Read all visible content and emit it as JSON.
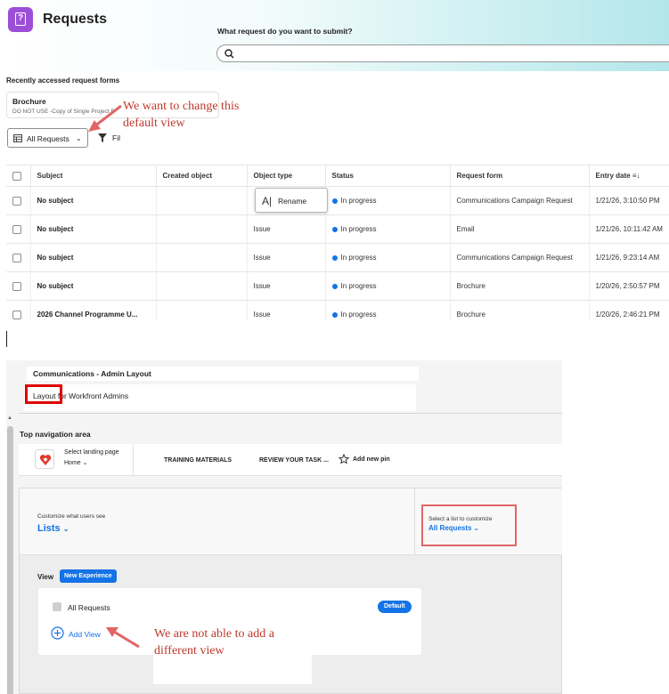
{
  "top": {
    "title": "Requests",
    "search_prompt": "What request do you want to submit?",
    "search_placeholder": "",
    "recent_label": "Recently accessed request forms",
    "recent_card": {
      "title": "Brochure",
      "subtitle": "DO NOT USE -Copy of Single Project B"
    },
    "view_selector": "All Requests",
    "filter_label": "Fil",
    "annotation": "We want to change this default view",
    "table": {
      "headers": [
        "Subject",
        "Created object",
        "Object type",
        "Status",
        "Request form",
        "Entry date"
      ],
      "rows": [
        {
          "subject": "No subject",
          "created": "",
          "type": "",
          "status": "In progress",
          "form": "Communications Campaign Request",
          "date": "1/21/26, 3:10:50 PM"
        },
        {
          "subject": "No subject",
          "created": "",
          "type": "Issue",
          "status": "In progress",
          "form": "Email",
          "date": "1/21/26, 10:11:42 AM"
        },
        {
          "subject": "No subject",
          "created": "",
          "type": "Issue",
          "status": "In progress",
          "form": "Communications Campaign Request",
          "date": "1/21/26, 9:23:14 AM"
        },
        {
          "subject": "No subject",
          "created": "",
          "type": "Issue",
          "status": "In progress",
          "form": "Brochure",
          "date": "1/20/26, 2:50:57 PM"
        },
        {
          "subject": "2026 Channel Programme U...",
          "created": "",
          "type": "Issue",
          "status": "In progress",
          "form": "Brochure",
          "date": "1/20/26, 2:46:21 PM"
        }
      ]
    },
    "rename_popup": "Rename"
  },
  "admin": {
    "layout_name": "Communications - Admin Layout",
    "layout_desc_highlight": "Layout",
    "layout_desc_rest": " for Workfront Admins",
    "topnav_label": "Top navigation area",
    "nav": {
      "landing_label": "Select landing page",
      "landing_value": "Home",
      "items": [
        "TRAINING MATERIALS",
        "REVIEW YOUR TASK ..."
      ],
      "add_pin": "Add new pin"
    },
    "customize_label": "Customize what users see",
    "customize_value": "Lists",
    "select_list_label": "Select a list to customize",
    "select_list_value": "All Requests",
    "view_label": "View",
    "new_experience": "New Experience",
    "view_name": "All Requests",
    "default_badge": "Default",
    "add_view": "Add View",
    "annotation": "We are not able to add a different view"
  },
  "colors": {
    "accent": "#1473e6",
    "app_icon": "#9c4fd6",
    "annotation": "#c0392b",
    "highlight_red": "#e00000",
    "highlight_pink": "#e06666"
  },
  "icons": [
    "request-form-icon",
    "search-icon",
    "table-view-icon",
    "chevron-down-icon",
    "filter-icon",
    "text-icon",
    "logo-icon",
    "pin-icon",
    "add-circle-icon",
    "sort-icon"
  ]
}
